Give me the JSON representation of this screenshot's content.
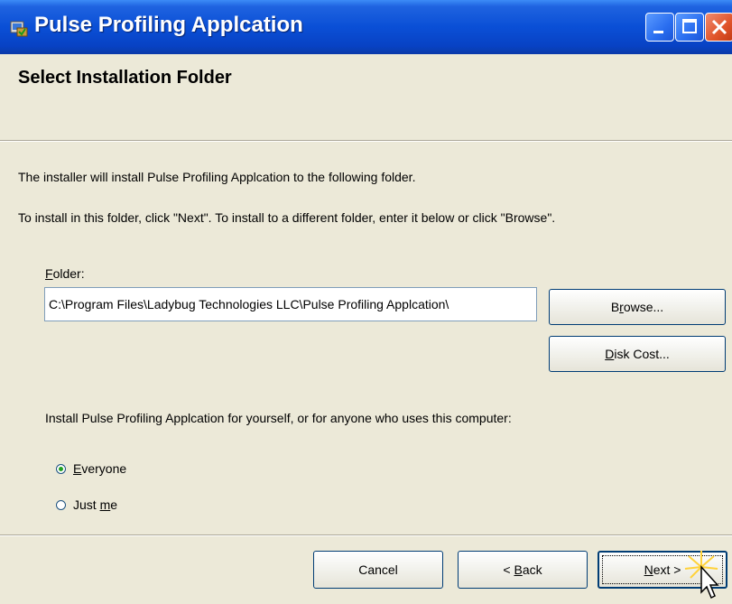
{
  "window": {
    "title": "Pulse Profiling Applcation",
    "icon": "installer-icon",
    "controls": [
      "minimize-icon",
      "maximize-icon",
      "close-icon"
    ]
  },
  "header": {
    "title": "Select Installation Folder"
  },
  "body": {
    "intro_line1": "The installer will install Pulse Profiling Applcation to the following folder.",
    "intro_line2": "To install in this folder, click \"Next\". To install to a different folder, enter it below or click \"Browse\".",
    "folder_label": "Folder:",
    "folder_value": "C:\\Program Files\\Ladybug Technologies LLC\\Pulse Profiling Applcation\\",
    "browse_label": "Browse...",
    "disk_cost_label": "Disk Cost...",
    "install_for_text": "Install Pulse Profiling Applcation for yourself, or for anyone who uses this computer:",
    "radio_options": [
      {
        "label": "Everyone",
        "checked": true
      },
      {
        "label": "Just me",
        "checked": false
      }
    ]
  },
  "footer": {
    "cancel_label": "Cancel",
    "back_label": "< Back",
    "next_label": "Next >"
  },
  "colors": {
    "titlebar": "#0a4fd6",
    "window_bg": "#ece9d8",
    "close_button": "#e0542a",
    "radio_dot": "#21a121"
  }
}
